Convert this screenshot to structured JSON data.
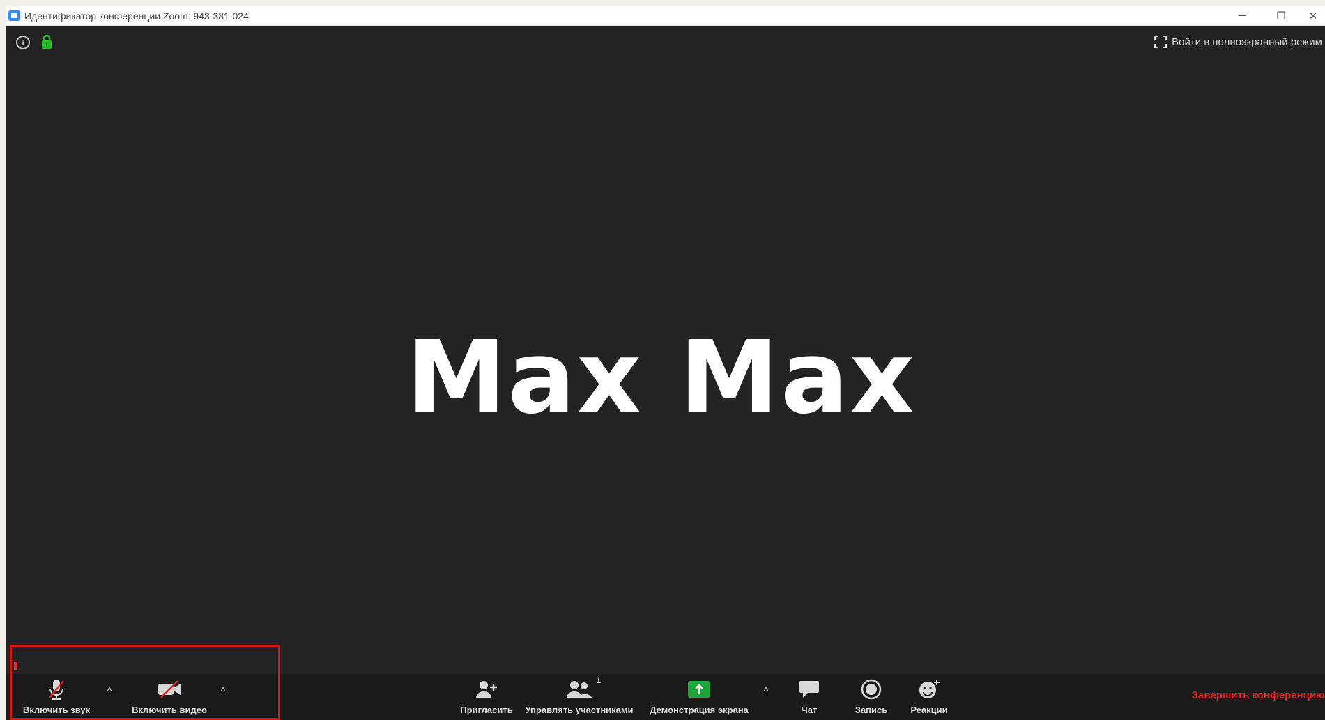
{
  "window": {
    "title": "Идентификатор конференции Zoom: 943-381-024",
    "controls": {
      "minimize": "─",
      "restore": "❐",
      "close": "✕"
    }
  },
  "top_bar": {
    "info_icon_glyph": "i",
    "fullscreen_label": "Войти в полноэкранный режим",
    "lock_color": "#1fc01f"
  },
  "participant": {
    "name": "Max Max"
  },
  "toolbar": {
    "audio_label": "Включить звук",
    "video_label": "Включить видео",
    "invite_label": "Пригласить",
    "participants_label": "Управлять участниками",
    "participants_count": "1",
    "share_label": "Демонстрация экрана",
    "chat_label": "Чат",
    "record_label": "Запись",
    "reactions_label": "Реакции",
    "end_label": "Завершить конференцию",
    "caret_glyph": "^",
    "share_color": "#1fa63a",
    "end_color": "#e02828"
  },
  "annotation": {
    "highlight_color": "#d11a1a"
  }
}
